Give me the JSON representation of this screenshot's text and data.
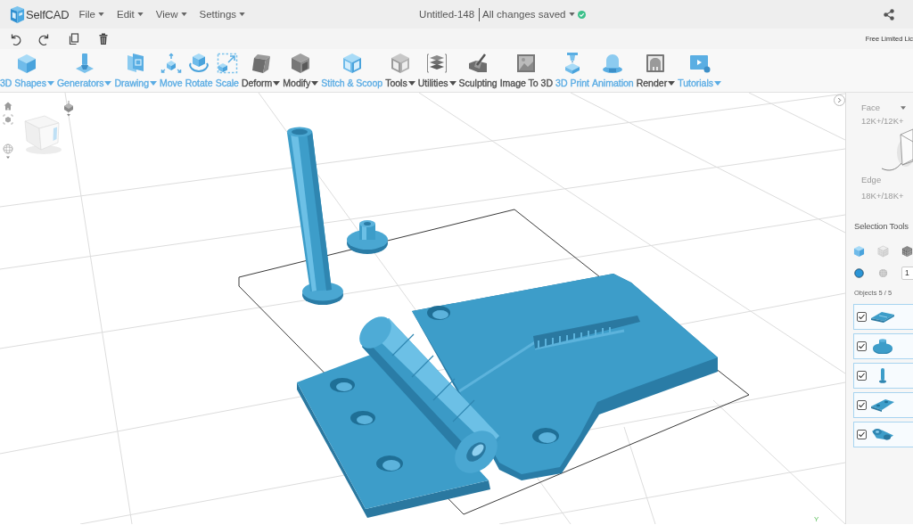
{
  "app": {
    "name": "SelfCAD"
  },
  "menus": [
    {
      "label": "File"
    },
    {
      "label": "Edit"
    },
    {
      "label": "View"
    },
    {
      "label": "Settings"
    }
  ],
  "document": {
    "title": "Untitled-148",
    "save_status": "All changes saved",
    "saved": true
  },
  "license_notice": "Free Limited Lic",
  "toolbar": [
    {
      "label": "3D Shapes",
      "color": "#5aace4",
      "has_menu": true
    },
    {
      "label": "Generators",
      "color": "#5aace4",
      "has_menu": true
    },
    {
      "label": "Drawing",
      "color": "#5aace4",
      "has_menu": true
    },
    {
      "label": "Move",
      "color": "#5aace4",
      "has_menu": false
    },
    {
      "label": "Rotate",
      "color": "#5aace4",
      "has_menu": false
    },
    {
      "label": "Scale",
      "color": "#5aace4",
      "has_menu": false
    },
    {
      "label": "Deform",
      "color": "#4d4d4d",
      "has_menu": true
    },
    {
      "label": "Modify",
      "color": "#4d4d4d",
      "has_menu": true
    },
    {
      "label": "Stitch & Scoop",
      "color": "#5aace4",
      "has_menu": false
    },
    {
      "label": "Tools",
      "color": "#4d4d4d",
      "has_menu": true
    },
    {
      "label": "Utilities",
      "color": "#4d4d4d",
      "has_menu": true
    },
    {
      "label": "Sculpting",
      "color": "#4d4d4d",
      "has_menu": false
    },
    {
      "label": "Image To 3D",
      "color": "#4d4d4d",
      "has_menu": false
    },
    {
      "label": "3D Print",
      "color": "#5aace4",
      "has_menu": false
    },
    {
      "label": "Animation",
      "color": "#5aace4",
      "has_menu": false
    },
    {
      "label": "Render",
      "color": "#4d4d4d",
      "has_menu": true
    },
    {
      "label": "Tutorials",
      "color": "#5aace4",
      "has_menu": true
    }
  ],
  "viewport": {
    "axis_label": "Y"
  },
  "panel": {
    "mode_label": "Face",
    "face_count": "12K+/12K+",
    "edge_label": "Edge",
    "edge_count": "18K+/18K+",
    "selection_title": "Selection Tools",
    "selection_modes": [
      {
        "selected": true
      },
      {
        "selected": false
      },
      {
        "selected": false
      }
    ],
    "brush_shapes": [
      {
        "selected": true
      },
      {
        "selected": false
      }
    ],
    "brush_size": "1",
    "objects_label": "Objects 5 / 5",
    "objects": [
      {
        "checked": true
      },
      {
        "checked": true
      },
      {
        "checked": true
      },
      {
        "checked": true
      },
      {
        "checked": true
      }
    ]
  }
}
